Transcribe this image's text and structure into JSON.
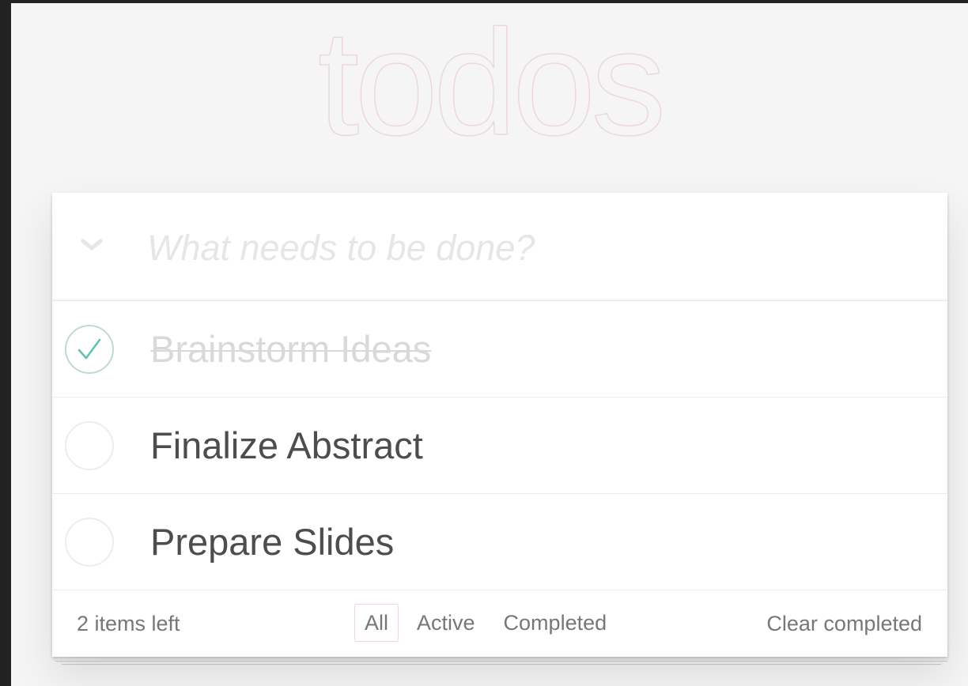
{
  "app": {
    "title": "todos",
    "colors": {
      "title": "#ecd6d6",
      "check_green": "#5dc2af",
      "text": "#4d4d4d",
      "completed_text": "#d9d9d9",
      "muted": "#777777"
    }
  },
  "header": {
    "toggle_all_icon": "chevron-down-icon",
    "new_todo_placeholder": "What needs to be done?",
    "new_todo_value": ""
  },
  "todos": [
    {
      "label": "Brainstorm Ideas",
      "completed": true
    },
    {
      "label": "Finalize Abstract",
      "completed": false
    },
    {
      "label": "Prepare Slides",
      "completed": false
    }
  ],
  "footer": {
    "count_text": "2 items left",
    "filters": [
      {
        "label": "All",
        "selected": true
      },
      {
        "label": "Active",
        "selected": false
      },
      {
        "label": "Completed",
        "selected": false
      }
    ],
    "clear_label": "Clear completed"
  }
}
